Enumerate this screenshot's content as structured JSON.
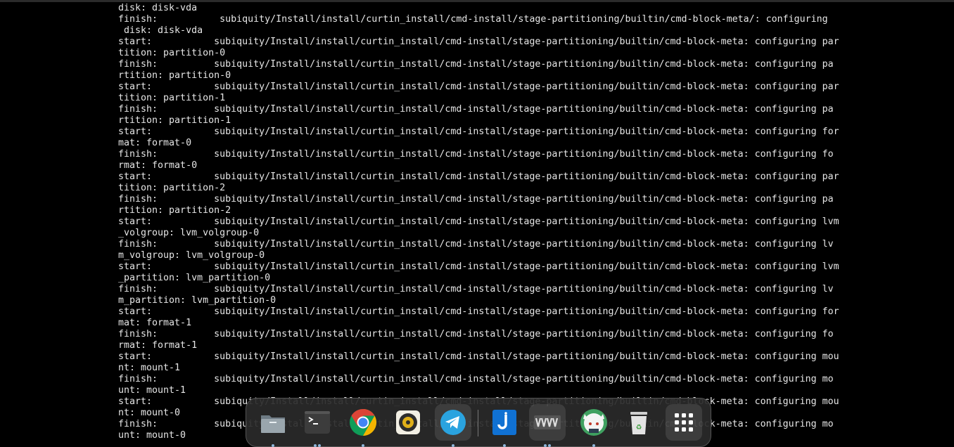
{
  "console": {
    "lines": [
      "disk: disk-vda",
      "finish:           subiquity/Install/install/curtin_install/cmd-install/stage-partitioning/builtin/cmd-block-meta/: configuring",
      " disk: disk-vda",
      "start:           subiquity/Install/install/curtin_install/cmd-install/stage-partitioning/builtin/cmd-block-meta: configuring par",
      "tition: partition-0",
      "finish:          subiquity/Install/install/curtin_install/cmd-install/stage-partitioning/builtin/cmd-block-meta: configuring pa",
      "rtition: partition-0",
      "start:           subiquity/Install/install/curtin_install/cmd-install/stage-partitioning/builtin/cmd-block-meta: configuring par",
      "tition: partition-1",
      "finish:          subiquity/Install/install/curtin_install/cmd-install/stage-partitioning/builtin/cmd-block-meta: configuring pa",
      "rtition: partition-1",
      "start:           subiquity/Install/install/curtin_install/cmd-install/stage-partitioning/builtin/cmd-block-meta: configuring for",
      "mat: format-0",
      "finish:          subiquity/Install/install/curtin_install/cmd-install/stage-partitioning/builtin/cmd-block-meta: configuring fo",
      "rmat: format-0",
      "start:           subiquity/Install/install/curtin_install/cmd-install/stage-partitioning/builtin/cmd-block-meta: configuring par",
      "tition: partition-2",
      "finish:          subiquity/Install/install/curtin_install/cmd-install/stage-partitioning/builtin/cmd-block-meta: configuring pa",
      "rtition: partition-2",
      "start:           subiquity/Install/install/curtin_install/cmd-install/stage-partitioning/builtin/cmd-block-meta: configuring lvm",
      "_volgroup: lvm_volgroup-0",
      "finish:          subiquity/Install/install/curtin_install/cmd-install/stage-partitioning/builtin/cmd-block-meta: configuring lv",
      "m_volgroup: lvm_volgroup-0",
      "start:           subiquity/Install/install/curtin_install/cmd-install/stage-partitioning/builtin/cmd-block-meta: configuring lvm",
      "_partition: lvm_partition-0",
      "finish:          subiquity/Install/install/curtin_install/cmd-install/stage-partitioning/builtin/cmd-block-meta: configuring lv",
      "m_partition: lvm_partition-0",
      "start:           subiquity/Install/install/curtin_install/cmd-install/stage-partitioning/builtin/cmd-block-meta: configuring for",
      "mat: format-1",
      "finish:          subiquity/Install/install/curtin_install/cmd-install/stage-partitioning/builtin/cmd-block-meta: configuring fo",
      "rmat: format-1",
      "start:           subiquity/Install/install/curtin_install/cmd-install/stage-partitioning/builtin/cmd-block-meta: configuring mou",
      "nt: mount-1",
      "finish:          subiquity/Install/install/curtin_install/cmd-install/stage-partitioning/builtin/cmd-block-meta: configuring mo",
      "unt: mount-1",
      "start:           subiquity/Install/install/curtin_install/cmd-install/stage-partitioning/builtin/cmd-block-meta: configuring mou",
      "nt: mount-0",
      "finish:          subiquity/Install/install/curtin_install/cmd-install/stage-partitioning/builtin/cmd-block-meta: configuring mo",
      "unt: mount-0"
    ]
  },
  "dock": {
    "apps": [
      {
        "icon": "files-icon",
        "running": 1,
        "active": false
      },
      {
        "icon": "terminal-icon",
        "running": 2,
        "active": false
      },
      {
        "icon": "chrome-icon",
        "running": 1,
        "active": false
      },
      {
        "icon": "rhythmbox-icon",
        "running": 0,
        "active": false
      },
      {
        "icon": "telegram-icon",
        "running": 1,
        "active": true
      },
      {
        "icon": "joplin-icon",
        "running": 1,
        "active": false
      },
      {
        "icon": "vmware-icon",
        "running": 2,
        "active": true
      },
      {
        "icon": "anime-avatar-icon",
        "running": 1,
        "active": false
      },
      {
        "icon": "trash-icon",
        "running": 0,
        "active": false
      },
      {
        "icon": "show-apps-icon",
        "running": 0,
        "active": true
      }
    ],
    "colors": {
      "running_dot": "#8fb8dc",
      "chrome_red": "#db4437",
      "chrome_yellow": "#f4b400",
      "chrome_green": "#0f9d58",
      "telegram": "#2aa3df",
      "joplin": "#1071d3"
    }
  }
}
